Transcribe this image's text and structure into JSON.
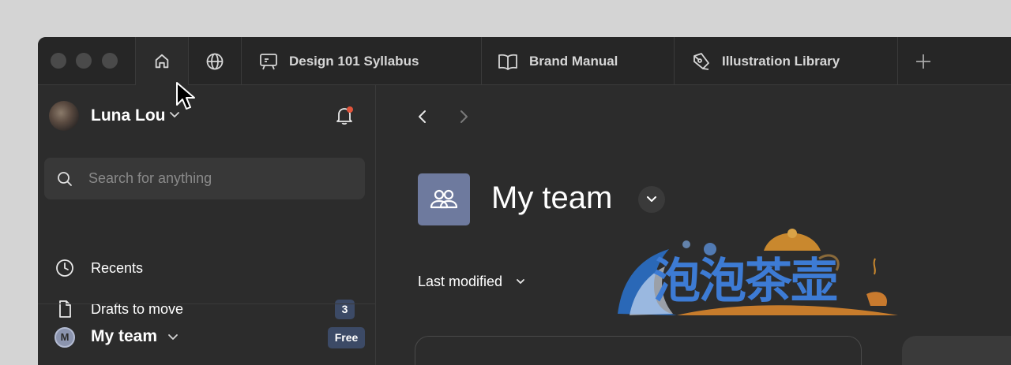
{
  "tabs": [
    {
      "label": "Design 101 Syllabus",
      "icon": "presentation-icon"
    },
    {
      "label": "Brand Manual",
      "icon": "book-icon"
    },
    {
      "label": "Illustration Library",
      "icon": "pen-tool-icon"
    }
  ],
  "user": {
    "name": "Luna Lou"
  },
  "search": {
    "placeholder": "Search for anything"
  },
  "nav": {
    "recents": "Recents",
    "drafts": "Drafts to move",
    "drafts_count": "3"
  },
  "team": {
    "initial": "M",
    "name": "My team",
    "plan": "Free"
  },
  "main": {
    "title": "My team",
    "sort": "Last modified"
  },
  "logo": {
    "text": "泡泡茶壶"
  },
  "colors": {
    "window_bg": "#2c2c2c",
    "tabbar_bg": "#262626",
    "badge_bg": "#3c4a66",
    "team_icon_bg": "#6e7a9e",
    "notification_dot": "#e2543b"
  }
}
